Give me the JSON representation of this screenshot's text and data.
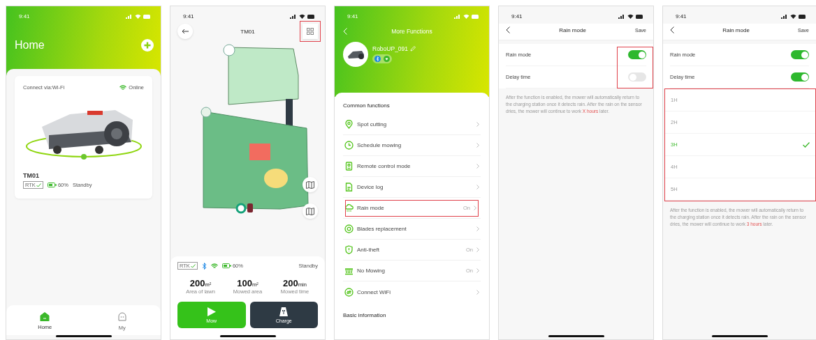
{
  "home_screen": {
    "time": "9:41",
    "title": "Home",
    "device_card": {
      "connection": "Connect via:Wi-Fi",
      "status": "Online",
      "name": "TM01",
      "rtk": "RTK",
      "battery": "60%",
      "state": "Standby"
    },
    "tabs": [
      {
        "label": "Home",
        "selected": true
      },
      {
        "label": "My",
        "selected": false
      }
    ]
  },
  "map_screen": {
    "time": "9:41",
    "title": "TM01",
    "layout_button_highlighted": true,
    "rtk": "RTK",
    "battery": "60%",
    "state": "Standby",
    "stats": [
      {
        "value": "200",
        "unit": "m²",
        "label": "Area of lawn"
      },
      {
        "value": "100",
        "unit": "m²",
        "label": "Mowed area"
      },
      {
        "value": "200",
        "unit": "min",
        "label": "Mowed time"
      }
    ],
    "actions": [
      {
        "label": "Mow",
        "kind": "mow"
      },
      {
        "label": "Charge",
        "kind": "charge"
      }
    ]
  },
  "functions_screen": {
    "time": "9:41",
    "title": "More Functions",
    "device_name": "RoboUP_091",
    "sections": [
      {
        "heading": "Common functions",
        "items": [
          {
            "label": "Spot cutting",
            "highlighted": false
          },
          {
            "label": "Schedule mowing",
            "highlighted": false
          },
          {
            "label": "Remote control mode",
            "highlighted": false
          },
          {
            "label": "Device log",
            "highlighted": false
          },
          {
            "label": "Rain mode",
            "value": "On",
            "highlighted": true
          },
          {
            "label": "Blades replacement",
            "highlighted": false
          },
          {
            "label": "Anti-theft",
            "value": "On",
            "highlighted": false
          },
          {
            "label": "No Mowing",
            "value": "On",
            "highlighted": false
          },
          {
            "label": "Connect WiFi",
            "highlighted": false
          }
        ]
      },
      {
        "heading": "Basic information"
      }
    ]
  },
  "rain_mode_screens": [
    {
      "time": "9:41",
      "title": "Rain mode",
      "action": "Save",
      "toggles_highlighted": true,
      "toggles": [
        {
          "label": "Rain mode",
          "on": true
        },
        {
          "label": "Delay time",
          "on": false
        }
      ],
      "note": {
        "text": "After the function is enabled, the mower will automatically return to the charging station once it detects rain. After the rain on the sensor dries, the mower will continue to work ",
        "emphasis": "X hours",
        "tail": " later."
      }
    },
    {
      "time": "9:41",
      "title": "Rain mode",
      "action": "Save",
      "toggles_highlighted": false,
      "toggles": [
        {
          "label": "Rain mode",
          "on": true
        },
        {
          "label": "Delay time",
          "on": true
        }
      ],
      "options_highlighted": true,
      "options": [
        {
          "label": "1H",
          "selected": false
        },
        {
          "label": "2H",
          "selected": false
        },
        {
          "label": "3H",
          "selected": true
        },
        {
          "label": "4H",
          "selected": false
        },
        {
          "label": "5H",
          "selected": false
        }
      ],
      "note": {
        "text": "After the function is enabled, the mower will automatically return to the charging station once it detects rain. After the rain on the sensor dries, the mower will continue to work ",
        "emphasis": "3 hours",
        "tail": " later."
      }
    }
  ]
}
